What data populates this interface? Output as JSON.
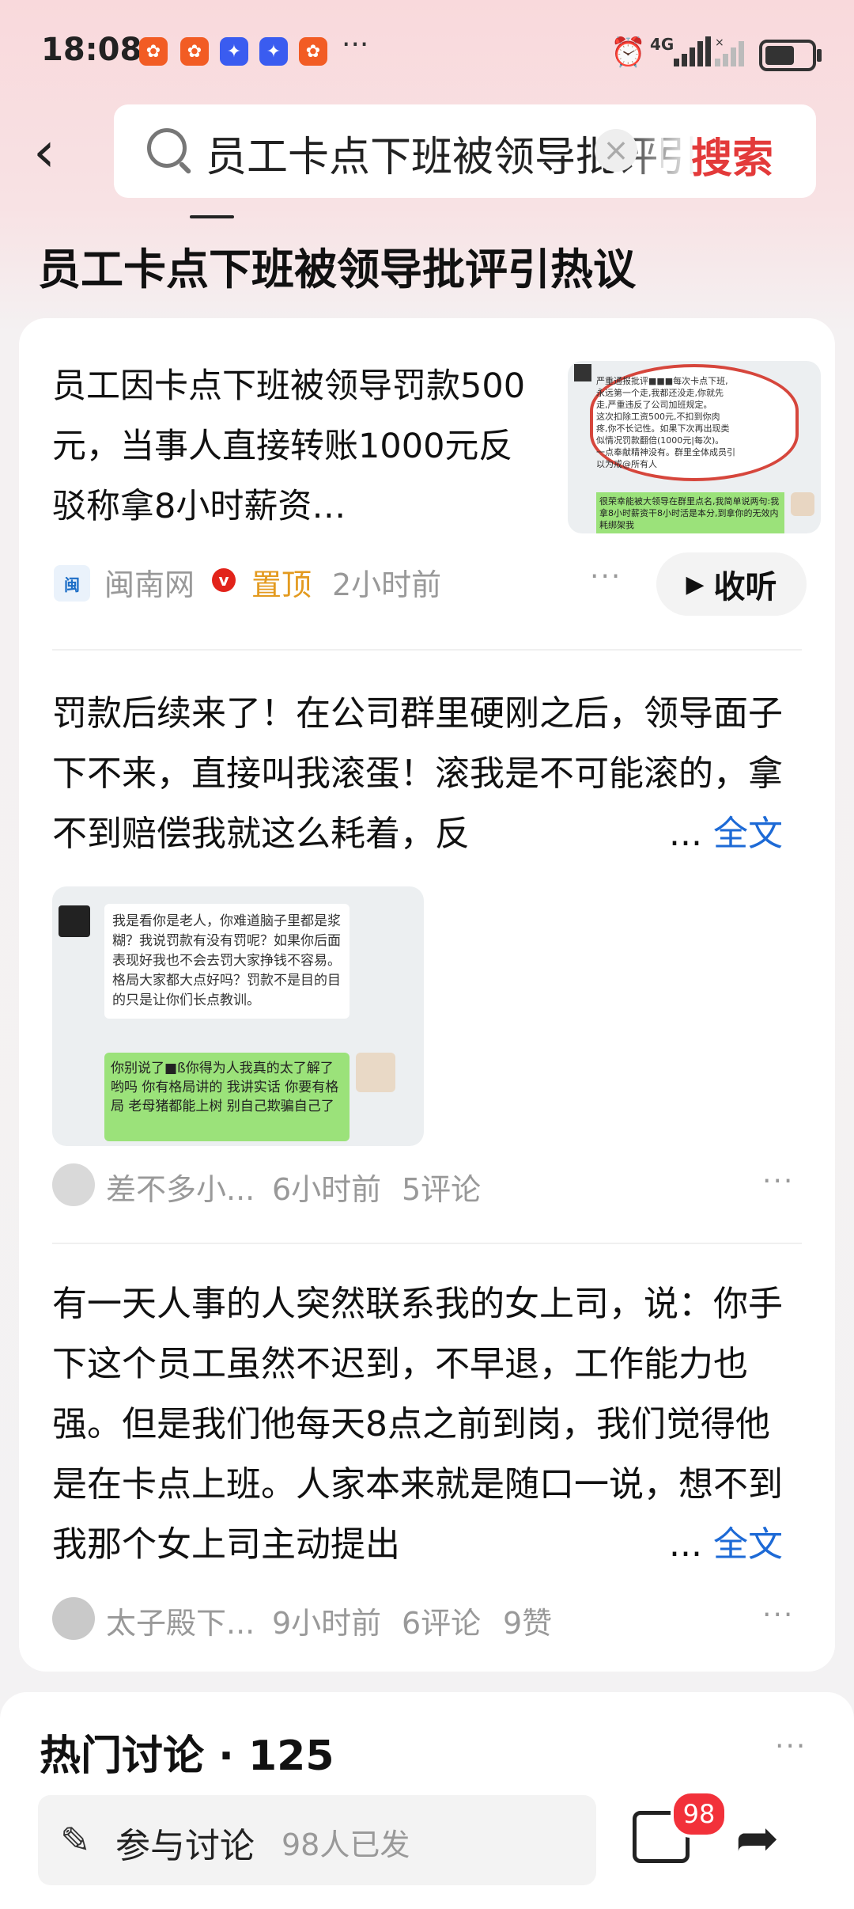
{
  "status_bar": {
    "time": "18:08",
    "network": "4G",
    "more": "···"
  },
  "search": {
    "query": "员工卡点下班被领导批评引热议",
    "button": "搜索"
  },
  "topic_title": "员工卡点下班被领导批评引热议",
  "post1": {
    "title": "员工因卡点下班被领导罚款500元，当事人直接转账1000元反驳称拿8小时薪资…",
    "source": "闽南网",
    "pinned": "置顶",
    "time": "2小时前",
    "listen_label": "收听",
    "thumb_lines": [
      "严重通报批评■■■每次卡点下班,",
      "永远第一个走,我都还没走,你就先",
      "走,严重违反了公司加班规定。",
      "这次扣除工资500元,不扣到你肉",
      "疼,你不长记性。如果下次再出现类",
      "似情况罚款翻倍(1000元|每次)。",
      "一点奉献精神没有。群里全体成员引",
      "以为戒@所有人"
    ],
    "thumb_reply": "很荣幸能被大领导在群里点名,我简单说两句:我拿8小时薪资干8小时活是本分,到拿你的无效内耗绑架我"
  },
  "post2": {
    "text": "罚款后续来了！在公司群里硬刚之后，领导面子下不来，直接叫我滚蛋！滚我是不可能滚的，拿不到赔偿我就这么耗着，反",
    "ellipsis": "...",
    "full": "全文",
    "image_msg1": "我是看你是老人，你难道脑子里都是浆糊？我说罚款有没有罚呢？如果你后面表现好我也不会去罚大家挣钱不容易。格局大家都大点好吗？罚款不是目的目的只是让你们长点教训。",
    "image_msg2": "你别说了■ß你得为人我真的太了解了 哟吗 你有格局讲的 我讲实话 你要有格局 老母猪都能上树 别自己欺骗自己了",
    "author": "差不多小...",
    "time": "6小时前",
    "comments": "5评论"
  },
  "post3": {
    "text": "有一天人事的人突然联系我的女上司，说：你手下这个员工虽然不迟到，不早退，工作能力也强。但是我们他每天8点之前到岗，我们觉得他是在卡点上班。人家本来就是随口一说，想不到我那个女上司主动提出",
    "ellipsis": "...",
    "full": "全文",
    "author": "太子殿下...",
    "time": "9小时前",
    "comments": "6评论",
    "likes": "9赞"
  },
  "hot": {
    "title": "热门讨论 · 125",
    "input_label": "参与讨论",
    "input_count": "98人已发",
    "badge": "98"
  },
  "colors": {
    "accent_red": "#e33a3a",
    "link_blue": "#1d6ad6",
    "pin_orange": "#e39a1f"
  }
}
